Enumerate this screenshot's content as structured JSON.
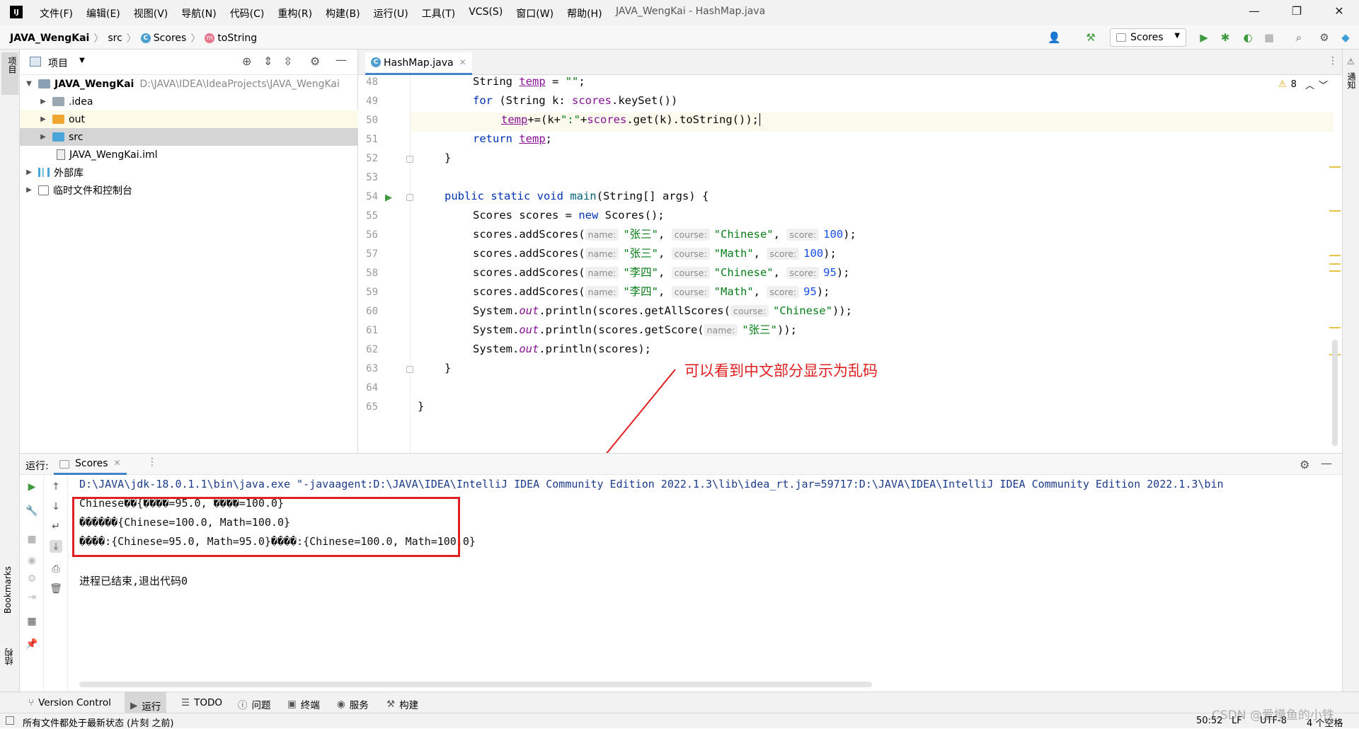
{
  "menubar": {
    "items": [
      "文件(F)",
      "编辑(E)",
      "视图(V)",
      "导航(N)",
      "代码(C)",
      "重构(R)",
      "构建(B)",
      "运行(U)",
      "工具(T)",
      "VCS(S)",
      "窗口(W)",
      "帮助(H)"
    ],
    "window_title": "JAVA_WengKai - HashMap.java",
    "logo_text": "IJ"
  },
  "navbar": {
    "project": "JAVA_WengKai",
    "folder": "src",
    "class": "Scores",
    "method": "toString",
    "run_config": "Scores"
  },
  "project_panel": {
    "title": "项目",
    "tree": [
      {
        "label": "JAVA_WengKai",
        "path": "D:\\JAVA\\IDEA\\IdeaProjects\\JAVA_WengKai",
        "expanded": true
      },
      {
        "label": ".idea"
      },
      {
        "label": "out"
      },
      {
        "label": "src"
      },
      {
        "label": "JAVA_WengKai.iml"
      },
      {
        "label": "外部库"
      },
      {
        "label": "临时文件和控制台"
      }
    ]
  },
  "editor": {
    "tab_label": "HashMap.java",
    "warnings": "8",
    "line_numbers": [
      "48",
      "49",
      "50",
      "51",
      "52",
      "53",
      "54",
      "55",
      "56",
      "57",
      "58",
      "59",
      "60",
      "61",
      "62",
      "63",
      "64",
      "65"
    ],
    "code": {
      "l48a": "String ",
      "l48b": "temp",
      "l48c": " = ",
      "l48d": "\"\"",
      "l48e": ";",
      "l49a": "for",
      "l49b": " (String k: ",
      "l49c": "scores",
      "l49d": ".keySet())",
      "l50a": "temp",
      "l50b": "+=(k+",
      "l50c": "\":\"",
      "l50d": "+",
      "l50e": "scores",
      "l50f": ".get(k).toString());",
      "l51a": "return ",
      "l51b": "temp",
      "l51c": ";",
      "l52": "}",
      "l54a": "public static void ",
      "l54b": "main",
      "l54c": "(String[] args) {",
      "l55a": "Scores scores = ",
      "l55b": "new ",
      "l55c": "Scores();",
      "call_add": "scores.addScores(",
      "hint_name": "name:",
      "hint_course": "course:",
      "hint_score": "score:",
      "s_zhangsan": "\"张三\"",
      "s_lisi": "\"李四\"",
      "s_chinese": "\"Chinese\"",
      "s_math": "\"Math\"",
      "n100": "100",
      "n95": "95",
      "comma": ", ",
      "close": ");",
      "sys": "System.",
      "out": "out",
      "println": ".println(",
      "l60a": "scores.getAllScores(",
      "l60b": "));",
      "l61a": "scores.getScore(",
      "l61b": "));",
      "l62a": "scores);",
      "l63": "}",
      "l65": "}"
    }
  },
  "annotation": "可以看到中文部分显示为乱码",
  "run_panel": {
    "label": "运行:",
    "tab": "Scores",
    "output": [
      "D:\\JAVA\\jdk-18.0.1.1\\bin\\java.exe \"-javaagent:D:\\JAVA\\IDEA\\IntelliJ IDEA Community Edition 2022.1.3\\lib\\idea_rt.jar=59717:D:\\JAVA\\IDEA\\IntelliJ IDEA Community Edition 2022.1.3\\bin",
      "Chinese��{����=95.0, ����=100.0}",
      "������{Chinese=100.0, Math=100.0}",
      "����:{Chinese=95.0, Math=95.0}����:{Chinese=100.0, Math=100.0}",
      "",
      "进程已结束,退出代码0"
    ]
  },
  "side_labels": {
    "left_top": "项目",
    "bookmarks": "Bookmarks",
    "structure": "结构",
    "right_top": "通知"
  },
  "bottom_tabs": [
    "Version Control",
    "运行",
    "TODO",
    "问题",
    "终端",
    "服务",
    "构建"
  ],
  "statusbar": {
    "left": "所有文件都处于最新状态 (片刻 之前)",
    "position": "50:52",
    "line_sep": "LF",
    "encoding": "UTF-8",
    "indent": "4 个空格",
    "watermark": "CSDN @爱摸鱼的小铁"
  },
  "colors": {
    "keyword": "#0033b3",
    "string": "#067d17",
    "field": "#871094",
    "number": "#1750eb",
    "annotation_red": "#e02020",
    "accent_blue": "#4083c9"
  }
}
